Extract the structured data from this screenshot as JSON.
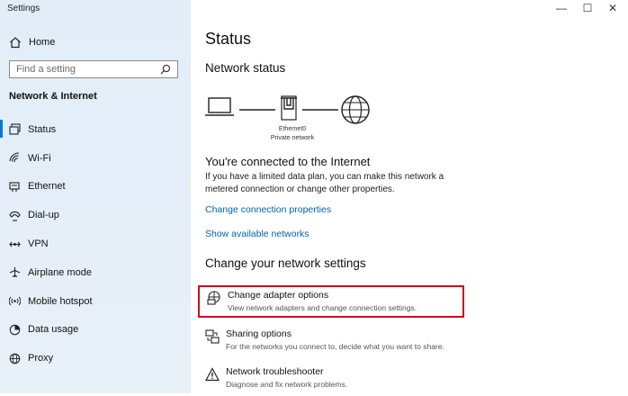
{
  "window": {
    "title": "Settings",
    "controls": {
      "minimize": "—",
      "maximize": "☐",
      "close": "✕"
    }
  },
  "sidebar": {
    "home_label": "Home",
    "search_placeholder": "Find a setting",
    "section_title": "Network & Internet",
    "items": [
      {
        "label": "Status",
        "icon": "status-icon",
        "active": true
      },
      {
        "label": "Wi-Fi",
        "icon": "wifi-icon"
      },
      {
        "label": "Ethernet",
        "icon": "ethernet-icon"
      },
      {
        "label": "Dial-up",
        "icon": "dialup-icon"
      },
      {
        "label": "VPN",
        "icon": "vpn-icon"
      },
      {
        "label": "Airplane mode",
        "icon": "airplane-icon"
      },
      {
        "label": "Mobile hotspot",
        "icon": "hotspot-icon"
      },
      {
        "label": "Data usage",
        "icon": "data-usage-icon"
      },
      {
        "label": "Proxy",
        "icon": "proxy-icon"
      }
    ]
  },
  "main": {
    "title": "Status",
    "network_status_heading": "Network status",
    "diagram": {
      "adapter_name": "Ethernet0",
      "network_type": "Private network"
    },
    "connected_heading": "You're connected to the Internet",
    "connected_text": "If you have a limited data plan, you can make this network a metered connection or change other properties.",
    "links": {
      "change_properties": "Change connection properties",
      "show_networks": "Show available networks"
    },
    "change_settings_heading": "Change your network settings",
    "options": [
      {
        "title": "Change adapter options",
        "desc": "View network adapters and change connection settings.",
        "icon": "adapter-icon",
        "highlighted": true
      },
      {
        "title": "Sharing options",
        "desc": "For the networks you connect to, decide what you want to share.",
        "icon": "sharing-icon"
      },
      {
        "title": "Network troubleshooter",
        "desc": "Diagnose and fix network problems.",
        "icon": "warning-icon"
      }
    ]
  },
  "colors": {
    "accent": "#0078d7",
    "link": "#0063b1",
    "highlight_border": "#c8101e",
    "sidebar_bg": "#e4eef8"
  }
}
